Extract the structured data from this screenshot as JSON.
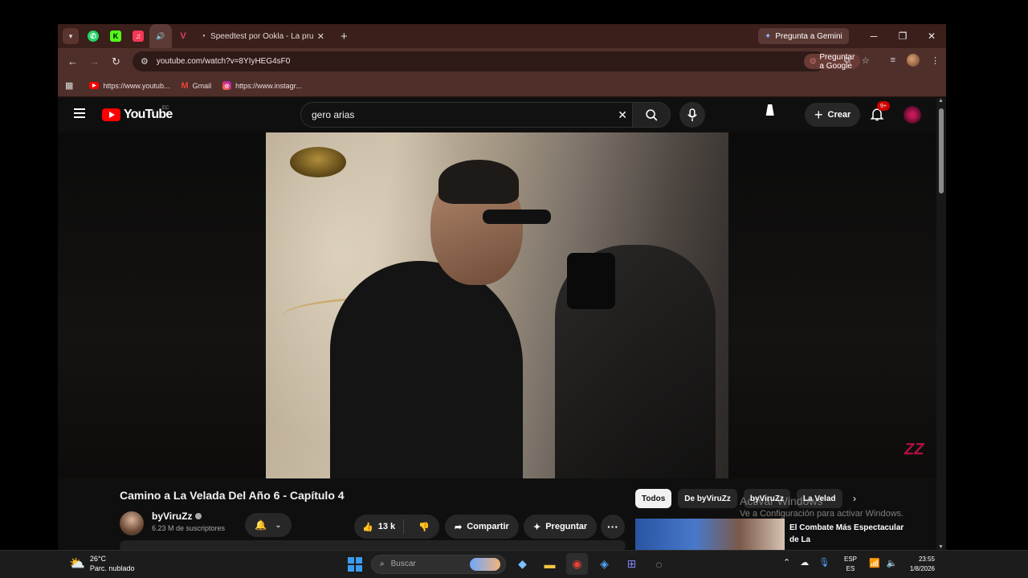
{
  "browser": {
    "tabs": [
      {
        "label": "Speedtest por Ookla - La prueb"
      }
    ],
    "gemini_label": "Pregunta a Gemini",
    "url": "youtube.com/watch?v=8YIyHEG4sF0",
    "ask_google_label": "Preguntar a Google",
    "bookmarks": [
      {
        "label": "https://www.youtub..."
      },
      {
        "label": "Gmail"
      },
      {
        "label": "https://www.instagr..."
      }
    ]
  },
  "youtube": {
    "logo_text": "YouTube",
    "country_code": "EC",
    "search_value": "gero arias",
    "create_label": "Crear",
    "notif_badge": "9+",
    "video_title": "Camino a La Velada Del Año 6 - Capítulo 4",
    "channel_name": "byViruZz",
    "subscribers": "6.23 M de suscriptores",
    "like_count": "13 k",
    "share_label": "Compartir",
    "ask_label": "Preguntar",
    "chips": [
      "Todos",
      "De byViruZz",
      "byViruZz",
      "La Velad"
    ],
    "rec_title": "El Combate Más Espectacular de La",
    "watermark": "ZZ"
  },
  "windows_activation": {
    "title": "Activar Windows",
    "subtitle": "Ve a Configuración para activar Windows."
  },
  "taskbar": {
    "temperature": "26°C",
    "weather": "Parc. nublado",
    "search_placeholder": "Buscar",
    "lang_top": "ESP",
    "lang_bottom": "ES",
    "time": "23:55",
    "date": "1/8/2026"
  },
  "colors": {
    "tab_bar": "#3a1f1b",
    "toolbar": "#4f2f2a",
    "yt_bg": "#0f0f0f",
    "yt_red": "#ff0000"
  }
}
